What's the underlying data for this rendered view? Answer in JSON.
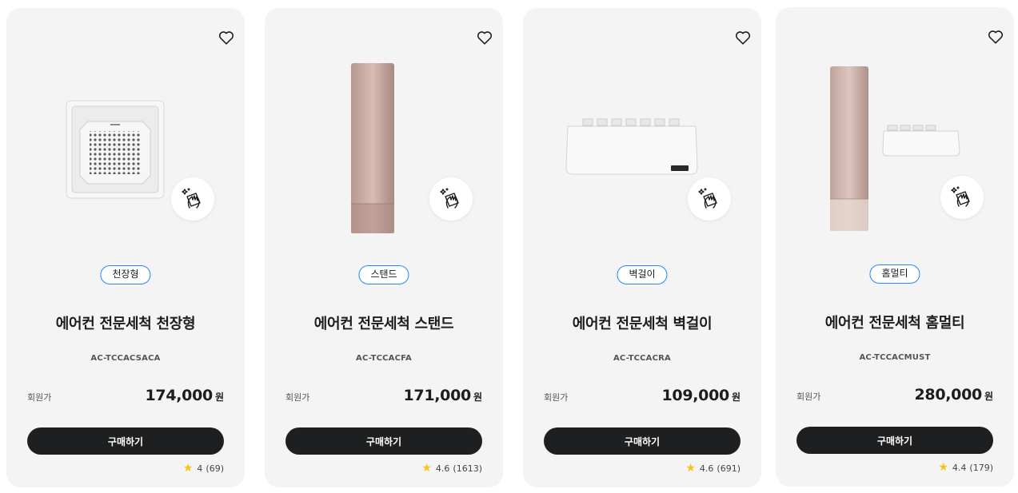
{
  "products": [
    {
      "type_chip": "천장형",
      "name": "에어컨 전문세척 천장형",
      "model": "AC-TCCACSACA",
      "price_label": "회원가",
      "price": "174,000",
      "currency": "원",
      "buy_label": "구매하기",
      "rating": "4",
      "review_count": "(69)",
      "image_icon": "ceiling-ac-image",
      "badge_icon": "cleaning-hand-icon"
    },
    {
      "type_chip": "스탠드",
      "name": "에어컨 전문세척 스탠드",
      "model": "AC-TCCACFA",
      "price_label": "회원가",
      "price": "171,000",
      "currency": "원",
      "buy_label": "구매하기",
      "rating": "4.6",
      "review_count": "(1613)",
      "image_icon": "stand-ac-image",
      "badge_icon": "cleaning-hand-icon"
    },
    {
      "type_chip": "벽걸이",
      "name": "에어컨 전문세척 벽걸이",
      "model": "AC-TCCACRA",
      "price_label": "회원가",
      "price": "109,000",
      "currency": "원",
      "buy_label": "구매하기",
      "rating": "4.6",
      "review_count": "(691)",
      "image_icon": "wall-ac-image",
      "badge_icon": "cleaning-hand-icon"
    },
    {
      "type_chip": "홈멀티",
      "name": "에어컨 전문세척 홈멀티",
      "model": "AC-TCCACMUST",
      "price_label": "회원가",
      "price": "280,000",
      "currency": "원",
      "buy_label": "구매하기",
      "rating": "4.4",
      "review_count": "(179)",
      "image_icon": "home-multi-ac-image",
      "badge_icon": "cleaning-hand-icon"
    }
  ],
  "colors": {
    "card_bg": "#f4f4f4",
    "chip_border": "#2189ff",
    "button_bg": "#1d1f20",
    "star": "#f5c518",
    "ac_pink": "#c9a9a0"
  }
}
